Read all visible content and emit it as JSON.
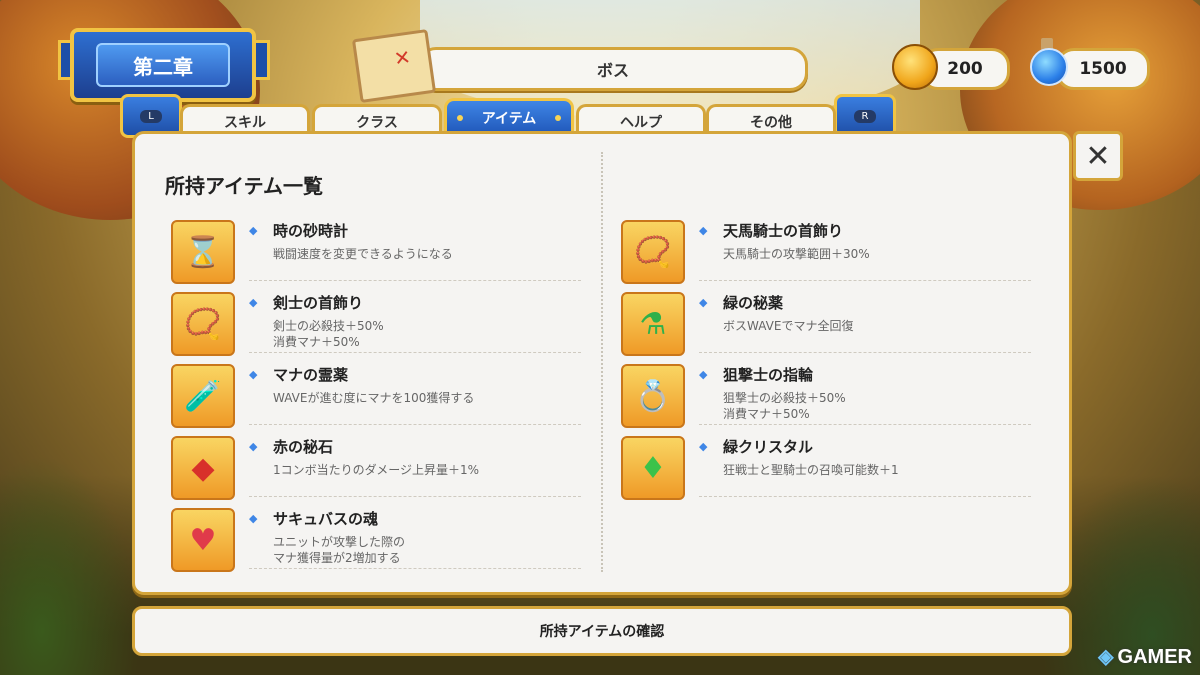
{
  "chapter": {
    "label": "第二章"
  },
  "stage": {
    "title": "ボス"
  },
  "currency": {
    "gold": "200",
    "mana": "1500"
  },
  "tab_nav": {
    "left_key": "L",
    "right_key": "R"
  },
  "tabs": [
    {
      "label": "スキル"
    },
    {
      "label": "クラス"
    },
    {
      "label": "アイテム",
      "active": true
    },
    {
      "label": "ヘルプ"
    },
    {
      "label": "その他"
    }
  ],
  "panel": {
    "title": "所持アイテム一覧",
    "left_items": [
      {
        "name": "時の砂時計",
        "desc": "戦闘速度を変更できるようになる",
        "icon": "hourglass-icon"
      },
      {
        "name": "剣士の首飾り",
        "desc": "剣士の必殺技＋50%\n消費マナ＋50%",
        "icon": "necklace-icon"
      },
      {
        "name": "マナの霊薬",
        "desc": "WAVEが進む度にマナを100獲得する",
        "icon": "potion-icon"
      },
      {
        "name": "赤の秘石",
        "desc": "1コンボ当たりのダメージ上昇量＋1%",
        "icon": "red-gem-icon"
      },
      {
        "name": "サキュバスの魂",
        "desc": "ユニットが攻撃した際の\nマナ獲得量が2増加する",
        "icon": "heart-icon"
      }
    ],
    "right_items": [
      {
        "name": "天馬騎士の首飾り",
        "desc": "天馬騎士の攻撃範囲＋30%",
        "icon": "necklace-icon"
      },
      {
        "name": "緑の秘薬",
        "desc": "ボスWAVEでマナ全回復",
        "icon": "green-potion-icon"
      },
      {
        "name": "狙撃士の指輪",
        "desc": "狙撃士の必殺技＋50%\n消費マナ＋50%",
        "icon": "ring-icon"
      },
      {
        "name": "緑クリスタル",
        "desc": "狂戦士と聖騎士の召喚可能数＋1",
        "icon": "green-crystal-icon"
      }
    ]
  },
  "confirm": {
    "label": "所持アイテムの確認"
  },
  "close": {
    "label": "✕"
  },
  "watermark": {
    "text": "GAMER"
  }
}
